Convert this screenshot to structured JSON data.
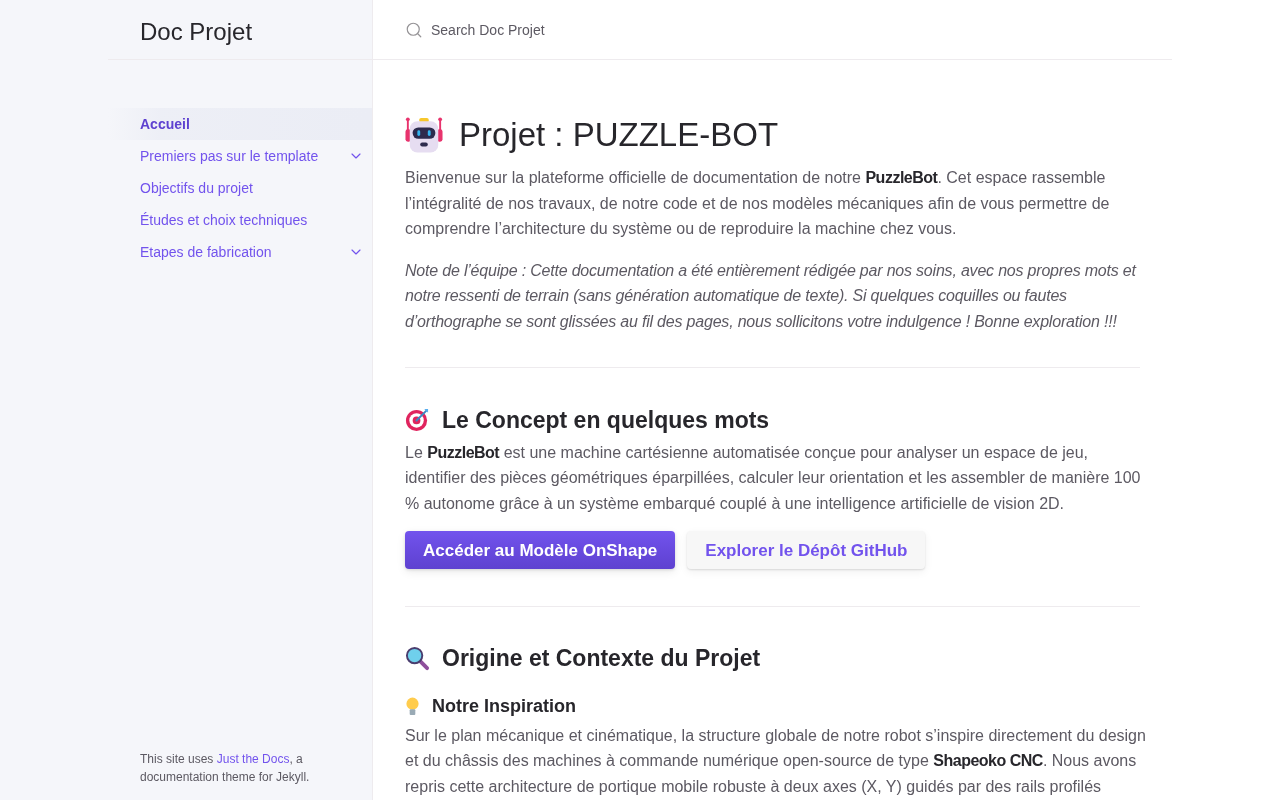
{
  "sidebar": {
    "site_title": "Doc Projet",
    "nav": [
      {
        "label": "Accueil",
        "selected": true
      },
      {
        "label": "Premiers pas sur le template",
        "selected": false,
        "expanded": false
      },
      {
        "label": "Objectifs du projet",
        "selected": false
      },
      {
        "label": "Études et choix techniques",
        "selected": false
      },
      {
        "label": "Etapes de fabrication",
        "selected": false,
        "expanded": false
      }
    ],
    "footer": {
      "text_before": "This site uses",
      "link": "Just the Docs",
      "text_after": ", a documentation theme for Jekyll."
    }
  },
  "search": {
    "placeholder": "Search Doc Projet"
  },
  "content": {
    "title": "Projet : PUZZLE-BOT",
    "intro": "Bienvenue sur la plateforme officielle de documentation de notre **PuzzleBot**. Cet espace rassemble l’intégralité de nos travaux, de notre code et de nos modèles mécaniques afin de vous permettre de comprendre l’architecture du système ou de reproduire la machine chez vous.",
    "note": "Note de l’équipe : Cette documentation a été entièrement rédigée par nos soins, avec nos propres mots et notre ressenti de terrain (sans génération automatique de texte). Si quelques coquilles ou fautes d’orthographe se sont glissées au fil des pages, nous sollicitons votre indulgence ! Bonne exploration !!!",
    "sections": [
      {
        "heading": "Le Concept en quelques mots",
        "body": "Le **PuzzleBot** est une machine cartésienne automatisée conçue pour analyser un espace de jeu, identifier des pièces géométriques éparpillées, calculer leur orientation et les assembler de manière 100 % autonome grâce à un système embarqué couplé à une intelligence artificielle de vision 2D.",
        "buttons": [
          {
            "label": "Accéder au Modèle OnShape",
            "kind": "primary"
          },
          {
            "label": "Explorer le Dépôt GitHub",
            "kind": "secondary"
          }
        ]
      },
      {
        "heading": "Origine et Contexte du Projet",
        "subsections": [
          {
            "heading": "Notre Inspiration",
            "body": "Sur le plan mécanique et cinématique, la structure globale de notre robot s’inspire directement du design et du châssis des machines à commande numérique open-source de type **Shapeoko CNC**. Nous avons repris cette architecture de portique mobile robuste à deux axes (X, Y) guidés par des rails profilés"
          }
        ]
      }
    ]
  }
}
